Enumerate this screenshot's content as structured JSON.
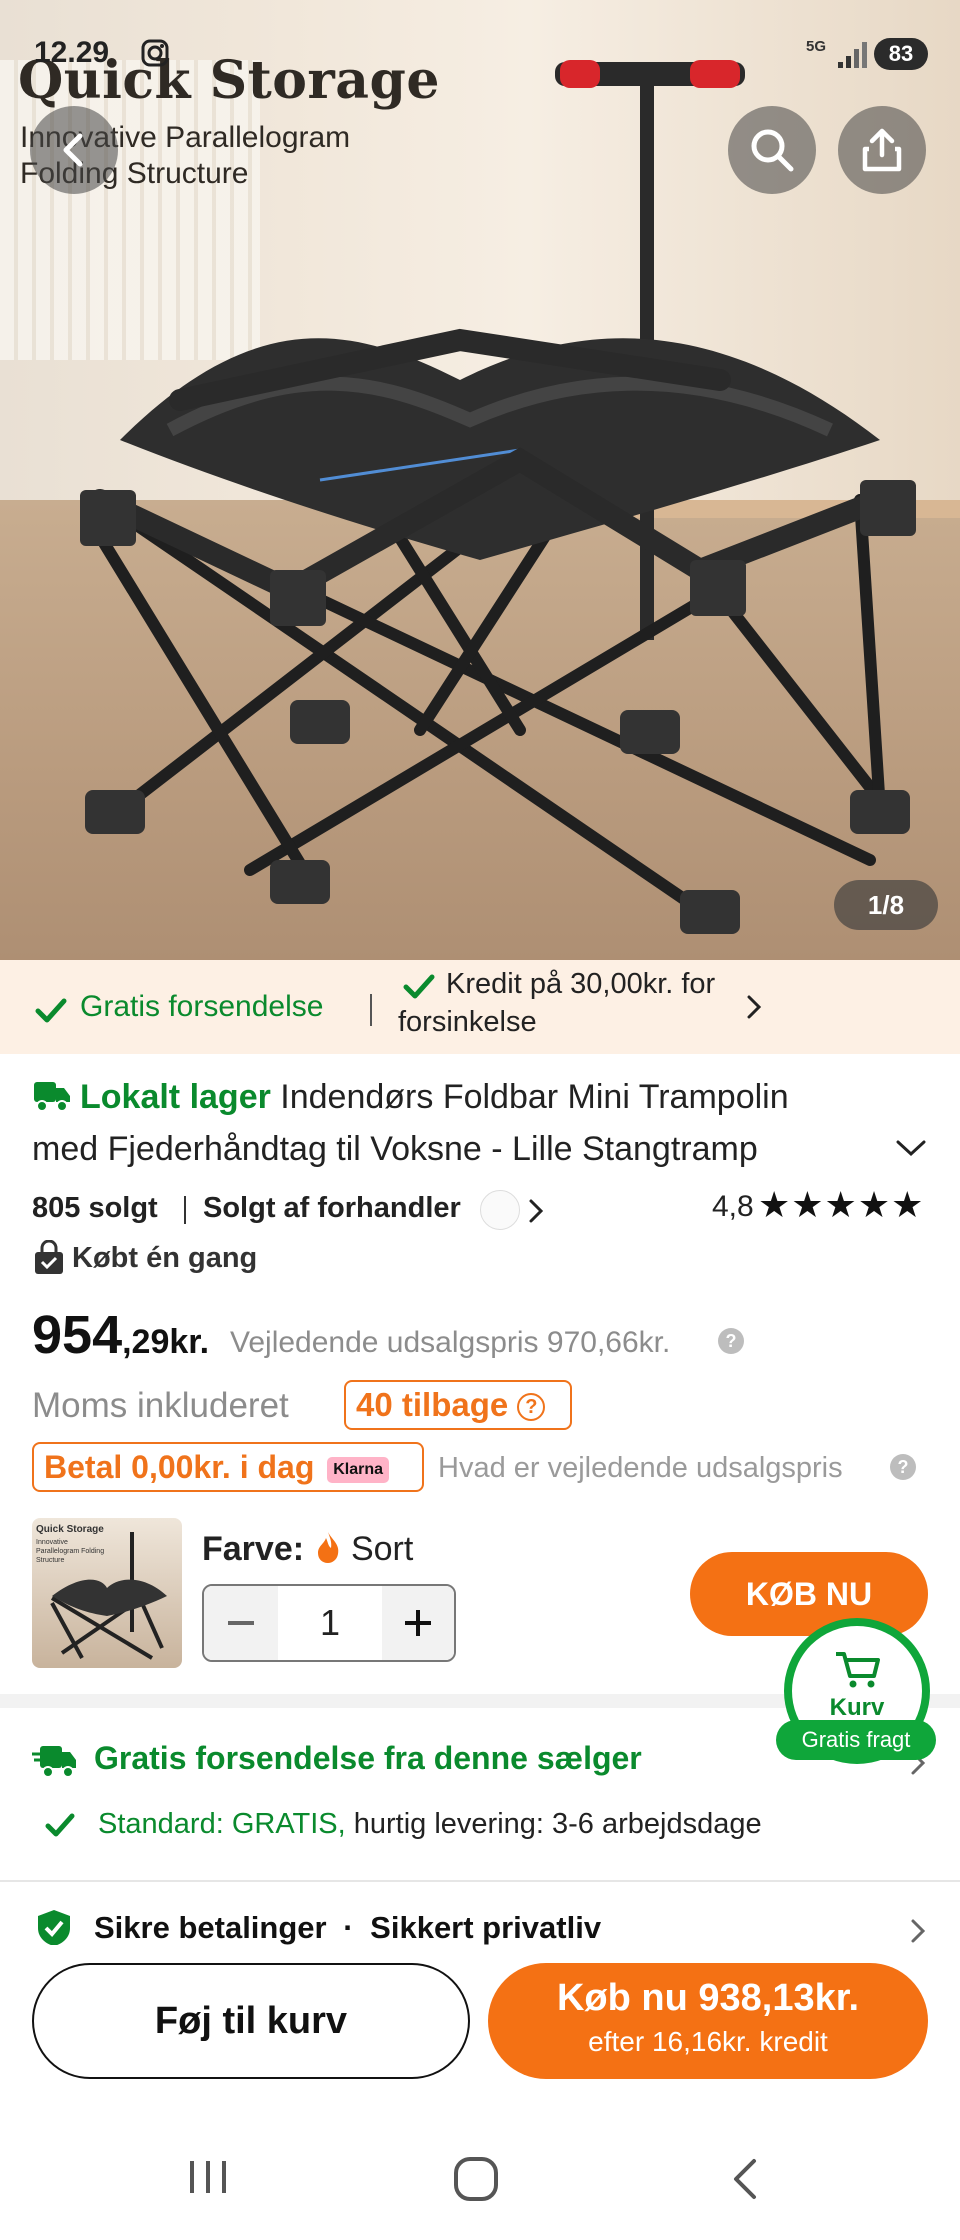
{
  "status_bar": {
    "time": "12.29",
    "network": "5G",
    "battery": "83"
  },
  "hero": {
    "brand_title": "Quick Storage",
    "brand_subtitle_line1": "Innovative Parallelogram",
    "brand_subtitle_line2": "Folding Structure",
    "pager": "1/8"
  },
  "promo": {
    "free_shipping": "Gratis forsendelse",
    "credit_line1": "Kredit på 30,00kr. for",
    "credit_line2": "forsinkelse"
  },
  "product": {
    "local_stock": "Lokalt lager",
    "title_line1": " Indendørs Foldbar Mini Trampolin",
    "title_line2": "med Fjederhåndtag til Voksne - Lille Stangtramp",
    "sold": "805 solgt",
    "seller": "Solgt af forhandler",
    "rating": "4,8",
    "stars": 5,
    "bought_once": "Købt én gang",
    "price_main": "954",
    "price_decimals": ",29kr.",
    "rrp_label": "Vejledende udsalgspris 970,66kr.",
    "vat": "Moms inkluderet",
    "left_badge": "40 tilbage",
    "pay_today": "Betal 0,00kr. i dag",
    "klarna": "Klarna",
    "rrp_question": "Hvad er vejledende udsalgspris",
    "color_label": "Farve:",
    "color_value": "Sort",
    "quantity": "1",
    "thumb_brand": "Quick Storage",
    "thumb_sub": "Innovative Parallelogram Folding Structure"
  },
  "buy_now_small": "KØB NU",
  "cart_float": {
    "label": "Kurv",
    "badge": "Gratis fragt"
  },
  "shipping": {
    "title": "Gratis forsendelse fra denne sælger",
    "standard_green": "Standard: GRATIS,",
    "standard_rest": " hurtig levering: 3-6 arbejdsdage"
  },
  "secure": {
    "payments": "Sikre betalinger",
    "privacy": "Sikkert privatliv"
  },
  "bottom": {
    "add_to_cart": "Føj til kurv",
    "buy_now_line1": "Køb nu 938,13kr.",
    "buy_now_line2": "efter 16,16kr. kredit"
  },
  "colors": {
    "accent_orange": "#f47114",
    "green": "#0a8a2d",
    "pink_klarna": "#ffb3c7"
  }
}
